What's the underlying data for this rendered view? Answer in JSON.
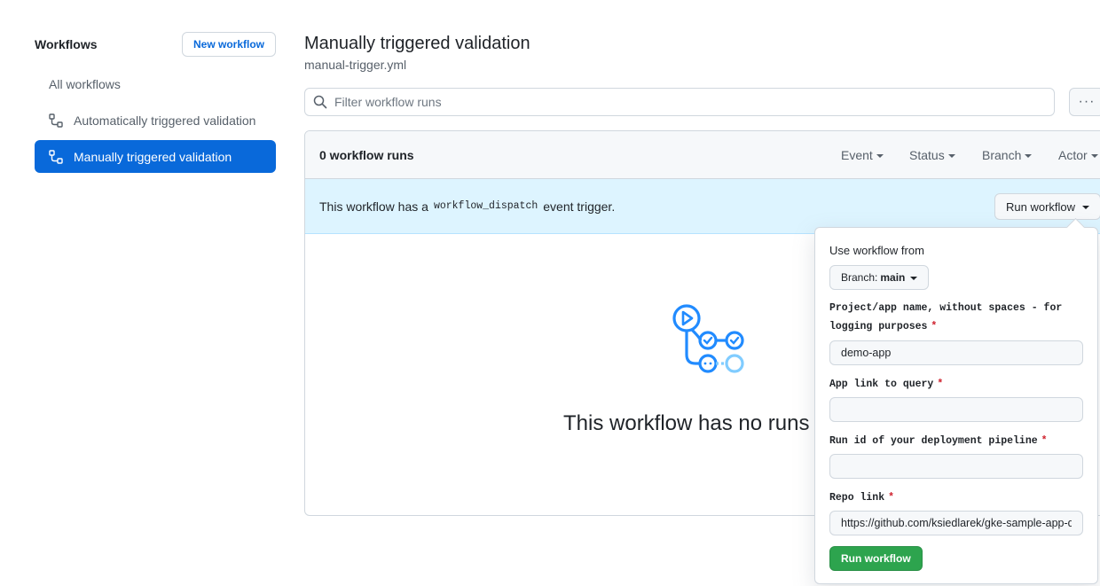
{
  "sidebar": {
    "title": "Workflows",
    "new_workflow_label": "New workflow",
    "items": [
      {
        "label": "All workflows",
        "icon": "none",
        "active": false
      },
      {
        "label": "Automatically triggered validation",
        "icon": "workflow-icon",
        "active": false
      },
      {
        "label": "Manually triggered validation",
        "icon": "workflow-icon",
        "active": true
      }
    ]
  },
  "main": {
    "title": "Manually triggered validation",
    "subtitle": "manual-trigger.yml",
    "filter_placeholder": "Filter workflow runs",
    "more_label": "···",
    "runs_count": "0 workflow runs",
    "filters": [
      "Event",
      "Status",
      "Branch",
      "Actor"
    ],
    "dispatch": {
      "text_before": "This workflow has a",
      "code": "workflow_dispatch",
      "text_after": "event trigger.",
      "run_button": "Run workflow"
    },
    "empty_title": "This workflow has no runs yet."
  },
  "popover": {
    "use_from_label": "Use workflow from",
    "branch_prefix": "Branch:",
    "branch_value": "main",
    "required_mark": "*",
    "fields": [
      {
        "label_line1": "Project/app name, without spaces - for",
        "label_line2": "logging purposes",
        "value": "demo-app"
      },
      {
        "label_line1": "App link to query",
        "label_line2": "",
        "value": ""
      },
      {
        "label_line1": "Run id of your deployment pipeline",
        "label_line2": "",
        "value": ""
      },
      {
        "label_line1": "Repo link",
        "label_line2": "",
        "value": "https://github.com/ksiedlarek/gke-sample-app-d"
      }
    ],
    "submit_label": "Run workflow"
  },
  "colors": {
    "accent": "#0969da",
    "success": "#2da44e",
    "info_bg": "#ddf4ff",
    "danger": "#cf222e"
  }
}
